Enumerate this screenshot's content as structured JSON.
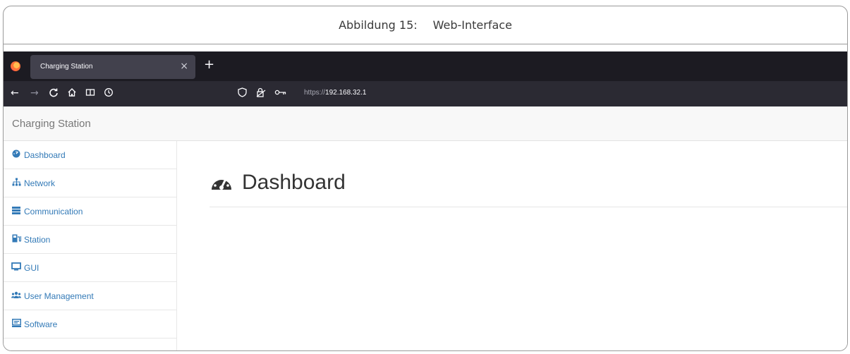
{
  "figure": {
    "caption_label": "Abbildung 15:",
    "caption_text": "Web-Interface"
  },
  "browser": {
    "tab": {
      "title": "Charging Station",
      "close_glyph": "×"
    },
    "new_tab_glyph": "+",
    "nav_icons": [
      "back-icon",
      "forward-icon",
      "reload-icon",
      "home-icon",
      "reader-icon",
      "history-icon"
    ],
    "url": {
      "protocol": "https://",
      "host": "192.168.32.1"
    }
  },
  "app": {
    "brand": "Charging Station",
    "sidebar": {
      "items": [
        {
          "label": "Dashboard",
          "icon": "dashboard-icon"
        },
        {
          "label": "Network",
          "icon": "network-icon"
        },
        {
          "label": "Communication",
          "icon": "list-icon"
        },
        {
          "label": "Station",
          "icon": "station-icon"
        },
        {
          "label": "GUI",
          "icon": "monitor-icon"
        },
        {
          "label": "User Management",
          "icon": "users-icon"
        },
        {
          "label": "Software",
          "icon": "software-icon"
        }
      ]
    },
    "main": {
      "title": "Dashboard",
      "title_icon": "dashboard-icon"
    }
  },
  "colors": {
    "tab_bar": "#1c1b22",
    "nav_bar": "#2b2a33",
    "active_tab": "#42414d",
    "link": "#337ab7"
  }
}
